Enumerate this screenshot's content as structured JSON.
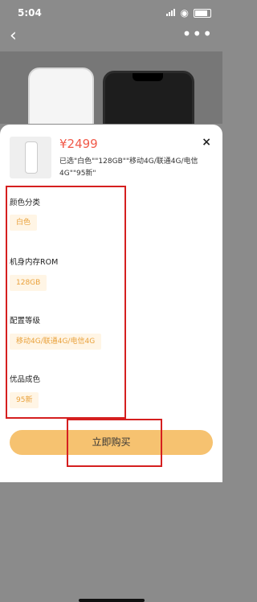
{
  "status": {
    "time": "5:04"
  },
  "nav": {
    "back_icon": "‹",
    "more_icon": "•••"
  },
  "product": {
    "price": "¥2499",
    "selected": "已选\"白色\"\"128GB\"\"移动4G/联通4G/电信4G\"\"95新\""
  },
  "close_icon": "×",
  "sections": [
    {
      "label": "颜色分类",
      "option": "白色"
    },
    {
      "label": "机身内存ROM",
      "option": "128GB"
    },
    {
      "label": "配置等级",
      "option": "移动4G/联通4G/电信4G"
    },
    {
      "label": "优品成色",
      "option": "95新"
    }
  ],
  "buy_button": "立即购买",
  "colors": {
    "accent": "#f15a4a",
    "chip_text": "#e9a13b",
    "chip_bg": "#fff5e5",
    "button": "#f6c270",
    "annotation": "#d51f1f"
  }
}
